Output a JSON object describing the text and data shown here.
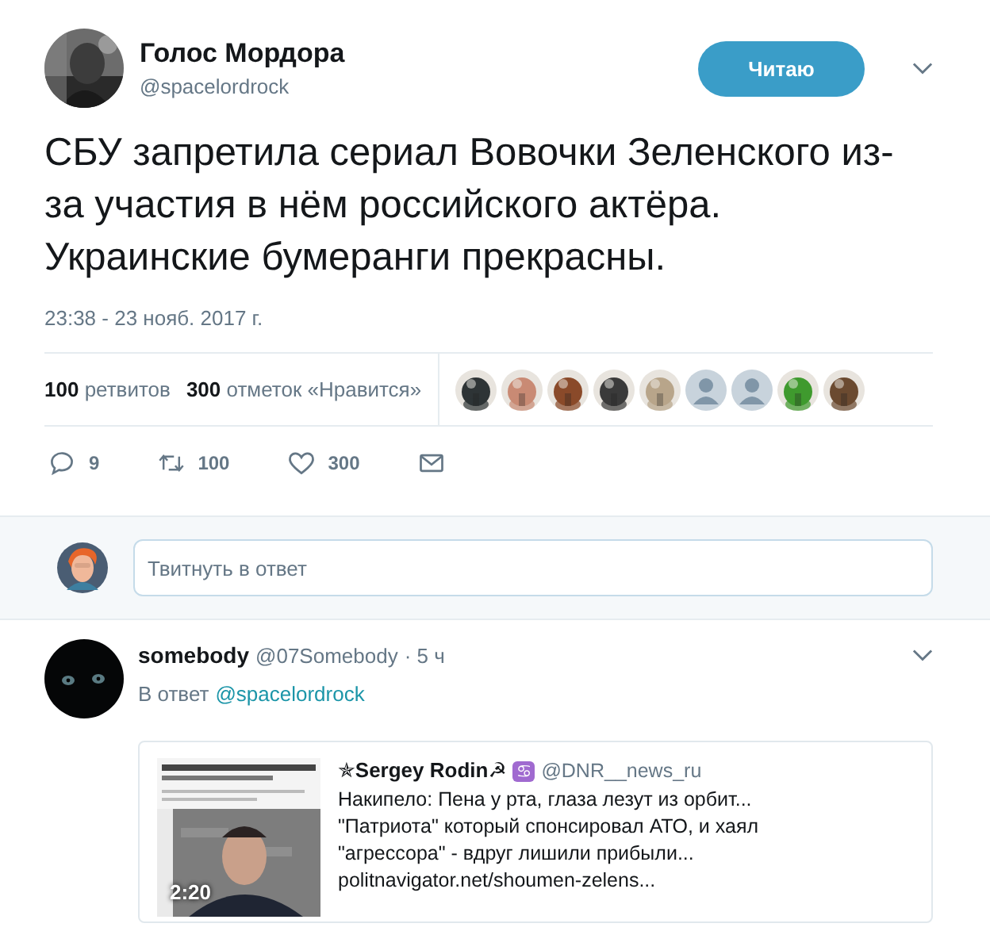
{
  "tweet": {
    "author": {
      "name": "Голос Мордора",
      "handle": "@spacelordrock",
      "avatar": {
        "kind": "picture"
      }
    },
    "follow_button": "Читаю",
    "text": "СБУ запретила сериал Вовочки Зеленского из-за участия в нём российского актёра. Украинские бумеранги прекрасны.",
    "timestamp": "23:38 - 23 нояб. 2017 г.",
    "stats": [
      {
        "count": "100",
        "label": "ретвитов"
      },
      {
        "count": "300",
        "label": "отметок «Нравится»"
      }
    ],
    "liked_by": [
      {
        "kind": "picture",
        "color": "#2e3436"
      },
      {
        "kind": "picture",
        "color": "#c98a74"
      },
      {
        "kind": "picture",
        "color": "#8a4a2a"
      },
      {
        "kind": "picture",
        "color": "#3a3a3a"
      },
      {
        "kind": "picture",
        "color": "#b8a58a"
      },
      {
        "kind": "default"
      },
      {
        "kind": "default"
      },
      {
        "kind": "picture",
        "color": "#3f9a2e"
      },
      {
        "kind": "picture",
        "color": "#6b4a30"
      }
    ],
    "actions": [
      {
        "kind": "reply",
        "count": "9"
      },
      {
        "kind": "retweet",
        "count": "100"
      },
      {
        "kind": "like",
        "count": "300"
      },
      {
        "kind": "message"
      }
    ]
  },
  "reply_box": {
    "placeholder": "Твитнуть в ответ"
  },
  "replies": [
    {
      "name": "somebody",
      "handle": "@07Somebody",
      "time": "· 5 ч",
      "in_reply_prefix": "В ответ",
      "in_reply_to": "@spacelordrock",
      "card": {
        "thumbnail": {
          "kind": "picture",
          "duration": "2:20"
        },
        "author_name": "✯Sergey Rodin☭",
        "author_badge": "♋",
        "author_handle": "@DNR__news_ru",
        "lines": [
          "Накипело: Пена у рта, глаза лезут из орбит...",
          "\"Патриота\" который спонсировал АТО, и хаял",
          "\"агрессора\" - вдруг лишили прибыли...",
          "politnavigator.net/shoumen-zelens..."
        ]
      }
    }
  ]
}
